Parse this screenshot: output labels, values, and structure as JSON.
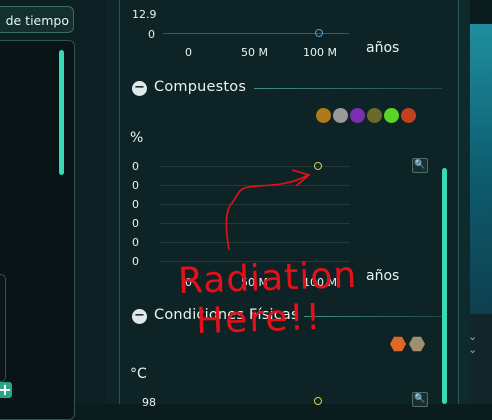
{
  "left": {
    "time_button": "de tiempo",
    "add_button": "+"
  },
  "top_chart": {
    "y_tick": "12.9",
    "y_zero": "0",
    "x_ticks": [
      "0",
      "50 M",
      "100 M"
    ],
    "x_label": "años"
  },
  "compounds": {
    "title": "Compuestos",
    "collapse": "−",
    "y_label": "%",
    "y_ticks": [
      "0",
      "0",
      "0",
      "0",
      "0",
      "0"
    ],
    "x_ticks": [
      "0",
      "50 M",
      "100 M"
    ],
    "x_label": "años",
    "icons": [
      {
        "name": "compound-1-icon",
        "color": "#b07a1a"
      },
      {
        "name": "compound-2-icon",
        "color": "#9a9a9a"
      },
      {
        "name": "compound-3-icon",
        "color": "#7a2fb0"
      },
      {
        "name": "compound-4-icon",
        "color": "#6a6a2a"
      },
      {
        "name": "compound-5-icon",
        "color": "#58d42a"
      },
      {
        "name": "compound-6-icon",
        "color": "#c0421c"
      }
    ]
  },
  "conditions": {
    "title": "Condiciones Físicas",
    "collapse": "−",
    "y_label": "°C",
    "y_tick": "98",
    "icons": [
      {
        "name": "temperature-icon",
        "color": "#e06a24"
      },
      {
        "name": "pressure-icon",
        "color": "#a09070"
      }
    ]
  },
  "annotation": {
    "line1": "Radiation",
    "line2": "Here!!"
  },
  "colors": {
    "accent": "#38d9b4",
    "annotation": "#e4111a",
    "point": "#d4d24a"
  }
}
